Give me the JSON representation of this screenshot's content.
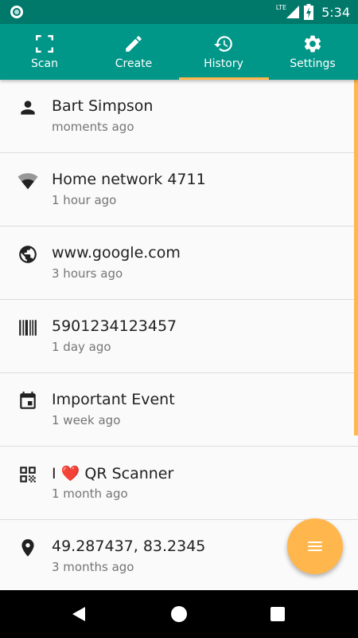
{
  "status_bar": {
    "network": "LTE",
    "time": "5:34"
  },
  "tabs": [
    {
      "label": "Scan",
      "icon": "scan-frame-icon"
    },
    {
      "label": "Create",
      "icon": "pencil-icon"
    },
    {
      "label": "History",
      "icon": "history-icon",
      "selected": true
    },
    {
      "label": "Settings",
      "icon": "gear-icon"
    }
  ],
  "history": [
    {
      "title": "Bart Simpson",
      "time": "moments ago",
      "icon": "person-icon"
    },
    {
      "title": "Home network 4711",
      "time": "1 hour ago",
      "icon": "wifi-icon"
    },
    {
      "title": "www.google.com",
      "time": "3 hours ago",
      "icon": "globe-icon"
    },
    {
      "title": "5901234123457",
      "time": "1 day ago",
      "icon": "barcode-icon"
    },
    {
      "title": "Important Event",
      "time": "1 week ago",
      "icon": "calendar-icon"
    },
    {
      "title_prefix": "I",
      "title_emoji": "❤️",
      "title_suffix": "QR Scanner",
      "time": "1 month ago",
      "icon": "qr-code-icon"
    },
    {
      "title": "49.287437, 83.2345",
      "time": "3 months ago",
      "icon": "location-pin-icon"
    }
  ],
  "fab": {
    "icon": "menu-icon"
  },
  "colors": {
    "status_bar": "#00796b",
    "app_bar": "#009688",
    "accent": "#ffb74d"
  }
}
